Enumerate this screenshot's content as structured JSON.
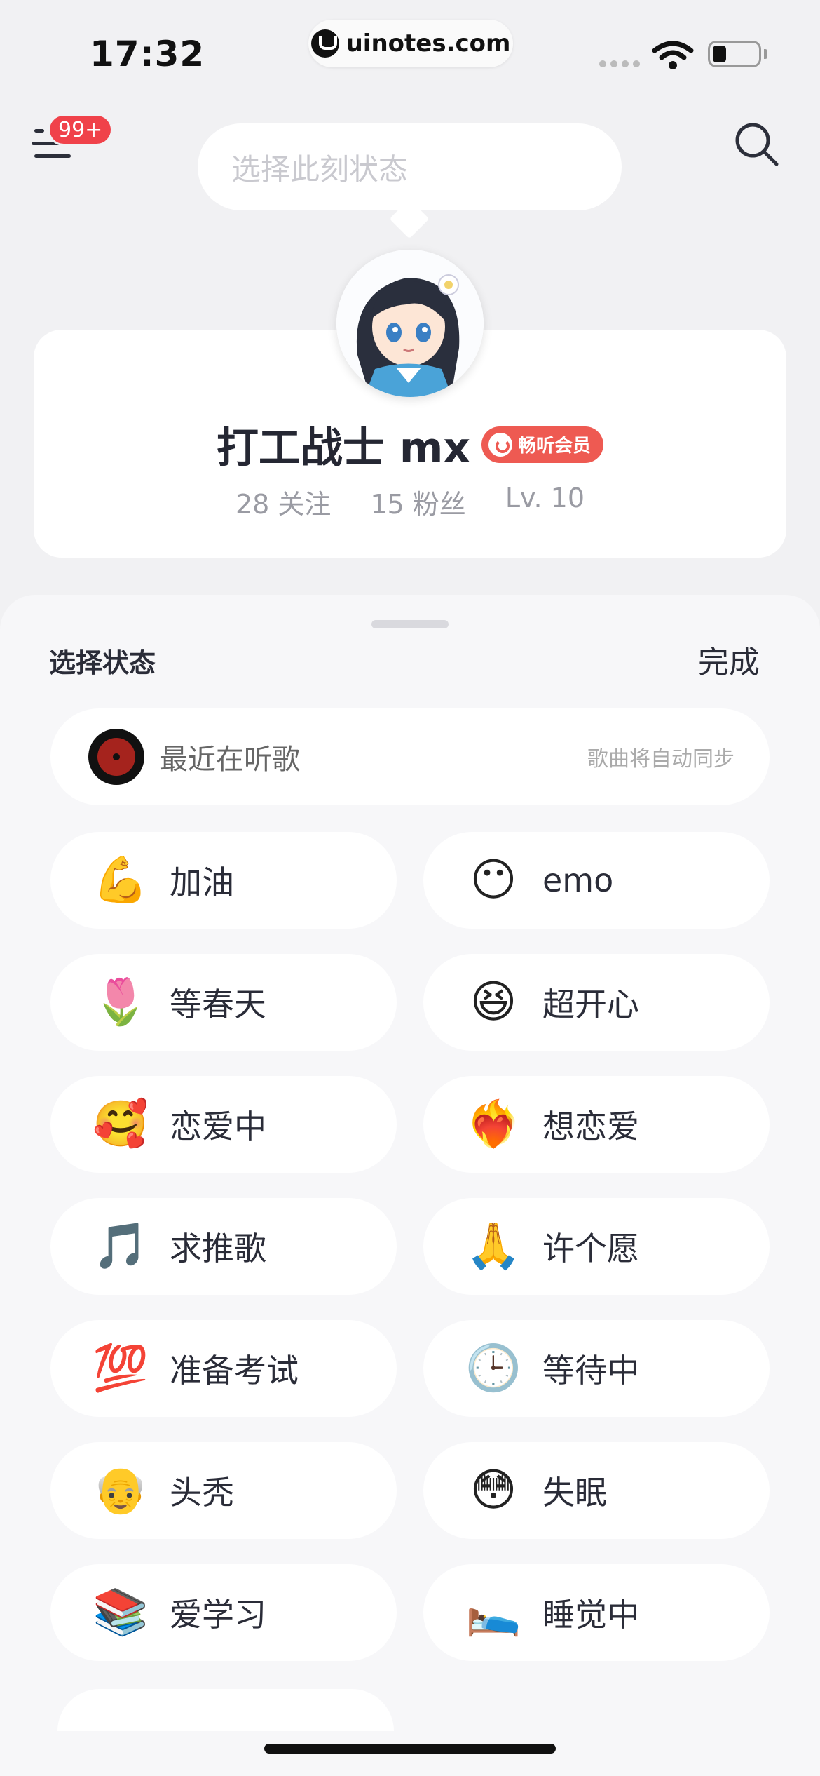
{
  "status_bar": {
    "time": "17:32",
    "url": "uinotes.com",
    "battery_level": 0.3
  },
  "nav": {
    "menu_icon": "menu-icon",
    "notification_badge": "99+",
    "search_icon": "search-icon"
  },
  "mood_bubble": {
    "placeholder": "选择此刻状态"
  },
  "profile": {
    "name": "打工战士 mx",
    "vip_label": "畅听会员",
    "following": "28 关注",
    "followers": "15 粉丝",
    "level": "Lv. 10"
  },
  "sheet": {
    "title": "选择状态",
    "done_label": "完成",
    "music": {
      "label": "最近在听歌",
      "hint": "歌曲将自动同步"
    },
    "statuses": [
      {
        "emoji": "💪",
        "label": "加油"
      },
      {
        "emoji": "😶",
        "label": "emo"
      },
      {
        "emoji": "🌷",
        "label": "等春天"
      },
      {
        "emoji": "😆",
        "label": "超开心"
      },
      {
        "emoji": "🥰",
        "label": "恋爱中"
      },
      {
        "emoji": "❤️‍🔥",
        "label": "想恋爱"
      },
      {
        "emoji": "🎵",
        "label": "求推歌"
      },
      {
        "emoji": "🙏",
        "label": "许个愿"
      },
      {
        "emoji": "💯",
        "label": "准备考试"
      },
      {
        "emoji": "🕒",
        "label": "等待中"
      },
      {
        "emoji": "👴",
        "label": "头秃"
      },
      {
        "emoji": "😳",
        "label": "失眠"
      },
      {
        "emoji": "📚",
        "label": "爱学习"
      },
      {
        "emoji": "🛌",
        "label": "睡觉中"
      }
    ]
  },
  "colors": {
    "accent_red": "#f0424a",
    "vip_red": "#ee5a52",
    "text_dark": "#2a2c38",
    "text_muted": "#9a9ba3"
  }
}
